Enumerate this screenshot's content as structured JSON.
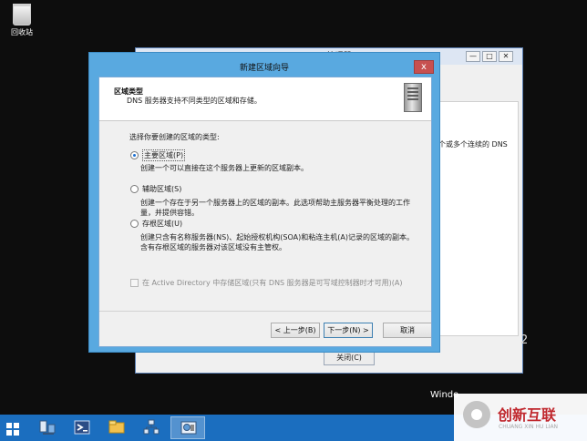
{
  "desktop": {
    "recycle_label": "回收站"
  },
  "bg_window": {
    "title": "DNS 管理器",
    "description_fragment": "个或多个连续的 DNS",
    "close_button": "关闭(C)",
    "controls": [
      "—",
      "□",
      "✕"
    ]
  },
  "wizard": {
    "title": "新建区域向导",
    "close_glyph": "x",
    "header_title": "区域类型",
    "header_subtitle": "DNS 服务器支持不同类型的区域和存储。",
    "prompt": "选择你要创建的区域的类型:",
    "options": [
      {
        "label": "主要区域(P)",
        "description": "创建一个可以直接在这个服务器上更新的区域副本。",
        "selected": true
      },
      {
        "label": "辅助区域(S)",
        "description": "创建一个存在于另一个服务器上的区域的副本。此选项帮助主服务器平衡处理的工作量，并提供容错。",
        "selected": false
      },
      {
        "label": "存根区域(U)",
        "description": "创建只含有名称服务器(NS)、起始授权机构(SOA)和粘连主机(A)记录的区域的副本。含有存根区域的服务器对该区域没有主管权。",
        "selected": false
      }
    ],
    "ad_checkbox": "在 Active Directory 中存储区域(只有 DNS 服务器是可写域控制器时才可用)(A)",
    "buttons": {
      "back": "< 上一步(B)",
      "next": "下一步(N) >",
      "cancel": "取消"
    }
  },
  "background_text": {
    "digit": "2",
    "windows_fragment": "Windo"
  },
  "watermark": {
    "main": "创新互联",
    "sub": "CHUANG XIN HU LIAN"
  },
  "taskbar": {
    "items": [
      "start-icon",
      "server-manager-icon",
      "powershell-icon",
      "file-explorer-icon",
      "network-icon",
      "dns-manager-icon"
    ]
  },
  "colors": {
    "accent": "#59a9e0",
    "taskbar": "#1b6ebf",
    "close_red": "#c75050"
  }
}
